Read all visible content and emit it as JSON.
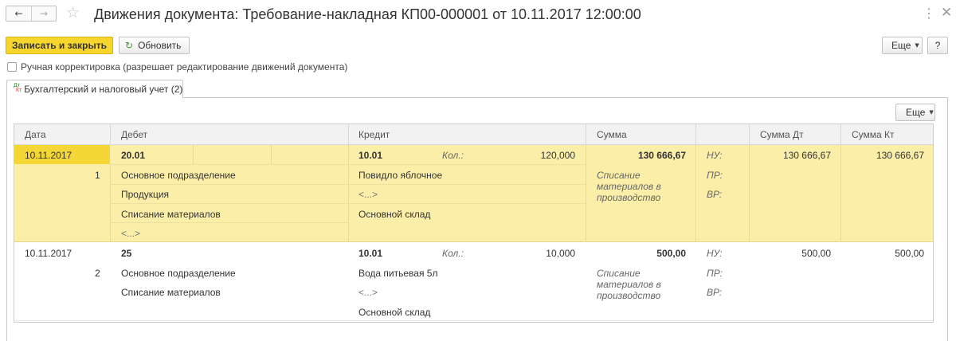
{
  "window": {
    "title": "Движения документа: Требование-накладная КП00-000001 от 10.11.2017 12:00:00"
  },
  "toolbar": {
    "post_close_label": "Записать и закрыть",
    "refresh_label": "Обновить",
    "more_label": "Еще",
    "help_label": "?"
  },
  "manual_edit": {
    "label": "Ручная корректировка (разрешает редактирование движений документа)",
    "checked": false
  },
  "tab": {
    "icon_dt": "Дт",
    "icon_kt": "Кт",
    "label": "Бухгалтерский и налоговый учет (2)"
  },
  "grid": {
    "more_label": "Еще",
    "headers": {
      "date": "Дата",
      "debit": "Дебет",
      "credit": "Кредит",
      "amount": "Сумма",
      "amount_dt": "Сумма Дт",
      "amount_kt": "Сумма Кт"
    },
    "rows": [
      {
        "date": "10.11.2017",
        "line_no": "1",
        "debit_account": "20.01",
        "debit_subconto": [
          "Основное подразделение",
          "Продукция",
          "Списание материалов",
          "<...>"
        ],
        "credit_account": "10.01",
        "qty_label": "Кол.:",
        "qty": "120,000",
        "credit_subconto": [
          "Повидло яблочное",
          "<...>",
          "Основной склад"
        ],
        "amount": "130 666,67",
        "content": "Списание материалов в производство",
        "nu_label": "НУ:",
        "pr_label": "ПР:",
        "vr_label": "ВР:",
        "amount_dt": "130 666,67",
        "amount_kt": "130 666,67"
      },
      {
        "date": "10.11.2017",
        "line_no": "2",
        "debit_account": "25",
        "debit_subconto": [
          "Основное подразделение",
          "Списание материалов"
        ],
        "credit_account": "10.01",
        "qty_label": "Кол.:",
        "qty": "10,000",
        "credit_subconto": [
          "Вода питьевая 5л",
          "<...>",
          "Основной склад"
        ],
        "amount": "500,00",
        "content": "Списание материалов в производство",
        "nu_label": "НУ:",
        "pr_label": "ПР:",
        "vr_label": "ВР:",
        "amount_dt": "500,00",
        "amount_kt": "500,00"
      }
    ]
  }
}
